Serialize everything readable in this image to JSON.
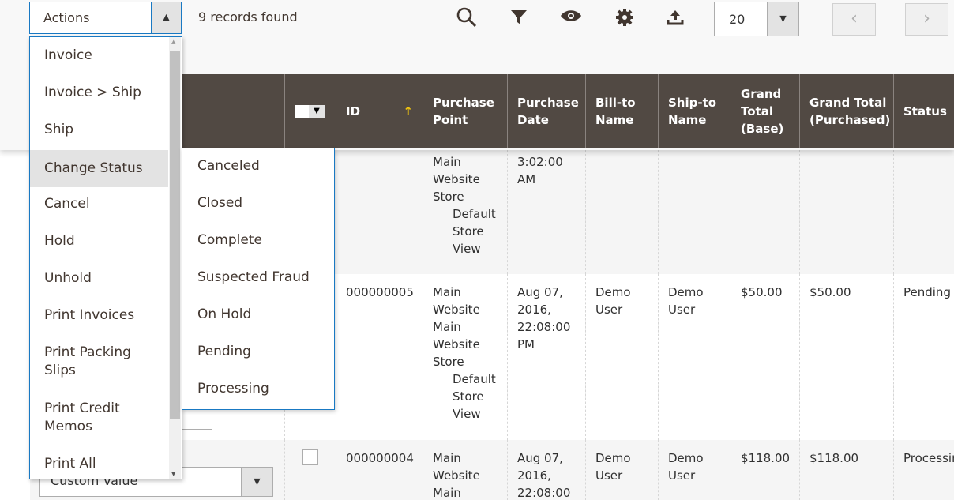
{
  "toolbar": {
    "actions_label": "Actions",
    "records": "9 records found",
    "per_page": "20",
    "icons": [
      "search-icon",
      "filter-icon",
      "eye-icon",
      "gear-icon",
      "export-icon"
    ],
    "prev": "‹",
    "next": "›"
  },
  "actions_menu": [
    "Invoice",
    "Invoice > Ship",
    "Ship",
    "Change Status",
    "Cancel",
    "Hold",
    "Unhold",
    "Print Invoices",
    "Print Packing Slips",
    "Print Credit Memos",
    "Print All"
  ],
  "status_submenu": [
    "Canceled",
    "Closed",
    "Complete",
    "Suspected Fraud",
    "On Hold",
    "Pending",
    "Processing"
  ],
  "columns": [
    "ID",
    "Purchase Point",
    "Purchase Date",
    "Bill-to Name",
    "Ship-to Name",
    "Grand Total (Base)",
    "Grand Total (Purchased)",
    "Status"
  ],
  "sort_arrow": "↑",
  "filter_select": "Custom Value",
  "rows": [
    {
      "id": "",
      "point": [
        "Main Website Store",
        "Default Store View"
      ],
      "date": "3:02:00 AM",
      "bill": "",
      "ship": "",
      "base": "",
      "purchased": "",
      "status": ""
    },
    {
      "id": "000000005",
      "point": [
        "Main Website",
        "Main Website Store",
        "Default Store View"
      ],
      "date": "Aug 07, 2016, 22:08:00 PM",
      "bill": "Demo User",
      "ship": "Demo User",
      "base": "$50.00",
      "purchased": "$50.00",
      "status": "Pending"
    },
    {
      "id": "000000004",
      "point": [
        "Main Website",
        "Main"
      ],
      "date": "Aug 07, 2016, 22:08:00",
      "bill": "Demo User",
      "ship": "Demo User",
      "base": "$118.00",
      "purchased": "$118.00",
      "status": "Processing"
    }
  ]
}
